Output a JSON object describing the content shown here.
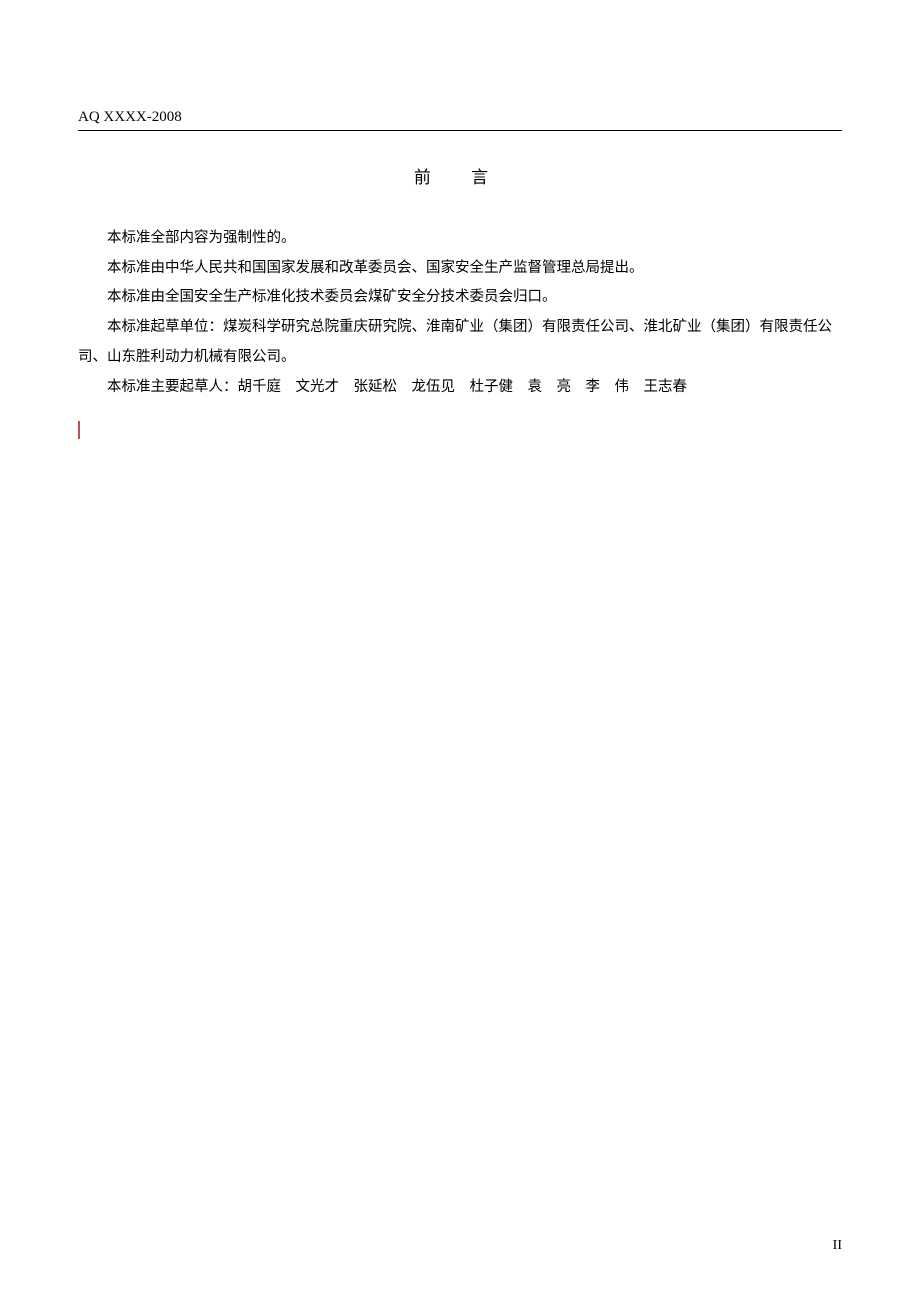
{
  "header": {
    "standard_code": "AQ XXXX-2008"
  },
  "title": "前 言",
  "paragraphs": {
    "p1": "本标准全部内容为强制性的。",
    "p2": "本标准由中华人民共和国国家发展和改革委员会、国家安全生产监督管理总局提出。",
    "p3": "本标准由全国安全生产标准化技术委员会煤矿安全分技术委员会归口。",
    "p4": "本标准起草单位：煤炭科学研究总院重庆研究院、淮南矿业（集团）有限责任公司、淮北矿业（集团）有限责任公司、山东胜利动力机械有限公司。",
    "p5": "本标准主要起草人：胡千庭　文光才　张延松　龙伍见　杜子健　袁　亮　李　伟　王志春"
  },
  "page_number": "II"
}
